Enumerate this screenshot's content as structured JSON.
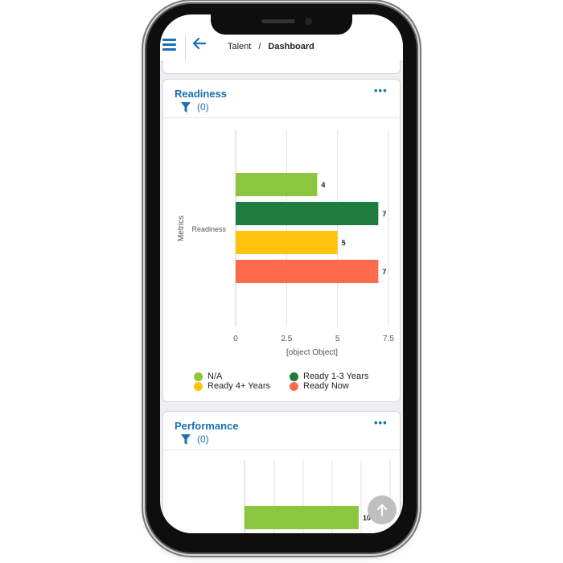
{
  "header": {
    "breadcrumb": {
      "root": "Talent",
      "separator": "/",
      "current": "Dashboard"
    }
  },
  "colors": {
    "accent": "#1a6fb5",
    "na": "#8cc63f",
    "ready_1_3": "#1e7d3e",
    "ready_4_plus": "#ffc20e",
    "ready_now": "#ff6a4d"
  },
  "readiness_card": {
    "title": "Readiness",
    "menu": "•••",
    "filter_count": "(0)",
    "chart_data": {
      "type": "bar",
      "orientation": "horizontal",
      "category": "Readiness",
      "ylabel": "Metrics",
      "xlabel": "[object Object]",
      "xlim": [
        0,
        7.5
      ],
      "xticks": [
        "0",
        "2.5",
        "5",
        "7.5"
      ],
      "grid": true,
      "series": [
        {
          "name": "N/A",
          "value": 4,
          "label": "4",
          "color": "#8cc63f"
        },
        {
          "name": "Ready 1-3 Years",
          "value": 7,
          "label": "7",
          "color": "#1e7d3e"
        },
        {
          "name": "Ready 4+ Years",
          "value": 5,
          "label": "5",
          "color": "#ffc20e"
        },
        {
          "name": "Ready Now",
          "value": 7,
          "label": "7",
          "color": "#ff6a4d"
        }
      ],
      "legend_placement": "bottom"
    },
    "legend": [
      {
        "label": "N/A",
        "color": "#8cc63f"
      },
      {
        "label": "Ready 1-3 Years",
        "color": "#1e7d3e"
      },
      {
        "label": "Ready 4+ Years",
        "color": "#ffc20e"
      },
      {
        "label": "Ready Now",
        "color": "#ff6a4d"
      }
    ]
  },
  "performance_card": {
    "title": "Performance",
    "menu": "•••",
    "filter_count": "(0)",
    "chart_data": {
      "type": "bar",
      "orientation": "horizontal",
      "grid": true,
      "series": [
        {
          "value": 10,
          "label": "10",
          "color": "#8cc63f"
        }
      ]
    }
  },
  "scroll_top": {
    "icon": "arrow-up-icon"
  }
}
